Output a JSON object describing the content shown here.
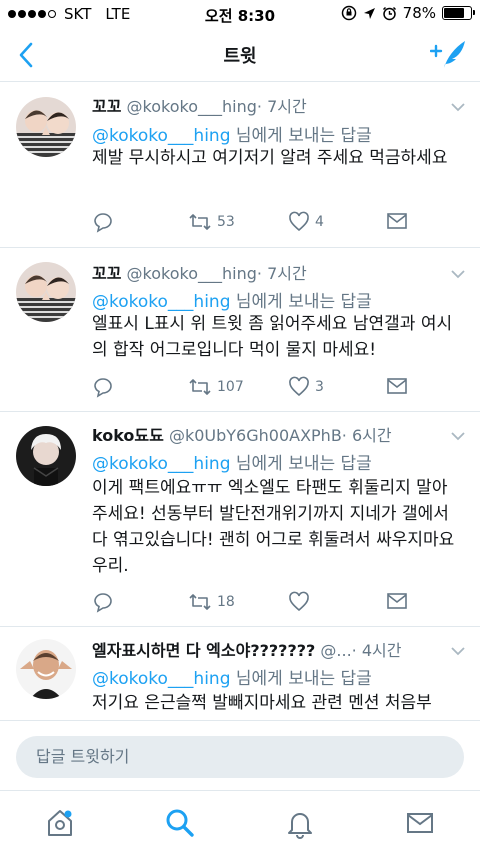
{
  "status_bar": {
    "carrier": "SKT",
    "network": "LTE",
    "time": "오전 8:30",
    "battery": "78%",
    "battery_level": 0.78
  },
  "nav": {
    "title": "트윗",
    "back_icon": "chevron-left-icon",
    "compose_icon": "compose-tweet-icon"
  },
  "colors": {
    "accent": "#1da1f2",
    "secondary_text": "#657786",
    "divider": "#e1e8ed"
  },
  "tweets": [
    {
      "name": "꼬꼬",
      "handle": "@kokoko___hing",
      "time": "· 7시간",
      "reply_handle": "@kokoko___hing",
      "reply_suffix": " 님에게 보내는 답글",
      "text": "제발 무시하시고 여기저기 알려 주세요 먹금하세요",
      "replies": "",
      "retweets": "53",
      "likes": "4"
    },
    {
      "name": "꼬꼬",
      "handle": "@kokoko___hing",
      "time": "· 7시간",
      "reply_handle": "@kokoko___hing",
      "reply_suffix": " 님에게 보내는 답글",
      "text": "엘표시 L표시 위 트윗 좀 읽어주세요 남연갤과 여시의 합작 어그로입니다 먹이 물지 마세요!",
      "replies": "",
      "retweets": "107",
      "likes": "3"
    },
    {
      "name": "koko됴됴",
      "handle": "@k0UbY6Gh00AXPhB",
      "time": "· 6시간",
      "reply_handle": "@kokoko___hing",
      "reply_suffix": " 님에게 보내는 답글",
      "text": "이게 팩트에요ㅠㅠ 엑소엘도 타팬도 휘둘리지 말아주세요! 선동부터 발단전개위기까지 지네가 갤에서 다 엮고있습니다! 괜히 어그로 휘둘려서 싸우지마요 우리.",
      "replies": "",
      "retweets": "18",
      "likes": ""
    },
    {
      "name": "엘자표시하면 다 엑소야???????",
      "handle": "@...",
      "time": "· 4시간",
      "reply_handle": "@kokoko___hing",
      "reply_suffix": " 님에게 보내는 답글",
      "text": "저기요 은근슬쩍 발빼지마세요 관련 멘션 처음부",
      "replies": "",
      "retweets": "",
      "likes": ""
    }
  ],
  "reply_bar": {
    "placeholder": "답글 트윗하기"
  },
  "tabs": [
    {
      "name": "home-icon"
    },
    {
      "name": "search-icon"
    },
    {
      "name": "notifications-icon"
    },
    {
      "name": "messages-icon"
    }
  ]
}
